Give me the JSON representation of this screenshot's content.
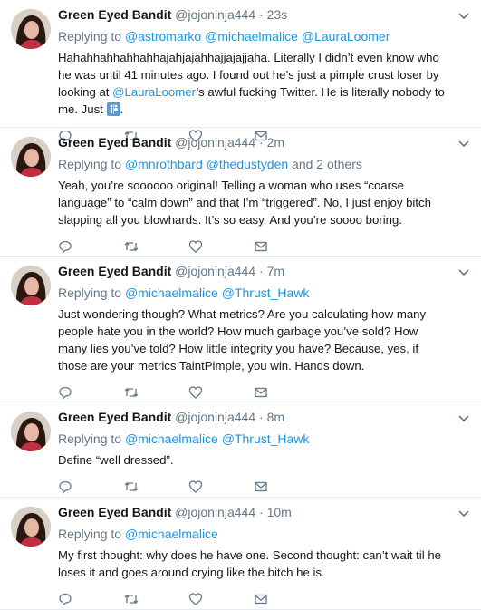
{
  "tweets": [
    {
      "name": "Green Eyed Bandit",
      "handle": "@jojoninja444",
      "dot": "·",
      "time": "23s",
      "replying_prefix": "Replying to",
      "mentions": [
        "@astromarko",
        "@michaelmalice",
        "@LauraLoomer"
      ],
      "suffix": "",
      "text_before": "Hahahhahhahhahhajahjajahhajjajajjaha. Literally I didn’t even know who he was until 41 minutes ago. I found out he’s just a pimple crust loser by looking at ",
      "text_mention": "@LauraLoomer",
      "text_after": "’s awful fucking Twitter. He is literally nobody to me. Just ",
      "text_end": "."
    },
    {
      "name": "Green Eyed Bandit",
      "handle": "@jojoninja444",
      "dot": "·",
      "time": "2m",
      "replying_prefix": "Replying to",
      "mentions": [
        "@mnrothbard",
        "@thedustyden"
      ],
      "suffix": "and 2 others",
      "text": "Yeah, you’re soooooo original! Telling a woman who uses “coarse language” to “calm down” and that I’m “triggered”. No, I just enjoy bitch slapping all you blowhards. It’s so easy. And you’re soooo boring."
    },
    {
      "name": "Green Eyed Bandit",
      "handle": "@jojoninja444",
      "dot": "·",
      "time": "7m",
      "replying_prefix": "Replying to",
      "mentions": [
        "@michaelmalice",
        "@Thrust_Hawk"
      ],
      "suffix": "",
      "text": "Just wondering though? What metrics? Are you calculating how many people hate you in the world? How much garbage you’ve sold? How many lies you’ve told? How little integrity you have? Because, yes, if those are your metrics TaintPimple, you win. Hands down."
    },
    {
      "name": "Green Eyed Bandit",
      "handle": "@jojoninja444",
      "dot": "·",
      "time": "8m",
      "replying_prefix": "Replying to",
      "mentions": [
        "@michaelmalice",
        "@Thrust_Hawk"
      ],
      "suffix": "",
      "text": "Define “well dressed”."
    },
    {
      "name": "Green Eyed Bandit",
      "handle": "@jojoninja444",
      "dot": "·",
      "time": "10m",
      "replying_prefix": "Replying to",
      "mentions": [
        "@michaelmalice"
      ],
      "suffix": "",
      "text": "My first thought: why does he have one. Second thought: can’t wait til he loses it and goes around crying like the bitch he is."
    }
  ],
  "icons": {
    "reply": "reply-icon",
    "retweet": "retweet-icon",
    "like": "heart-icon",
    "dm": "envelope-icon",
    "caret": "chevron-down-icon",
    "emoji": "restroom-emoji-icon"
  },
  "colors": {
    "link": "#1b95e0",
    "secondary": "#657786",
    "text": "#14171a",
    "divider": "#e6ecf0"
  }
}
